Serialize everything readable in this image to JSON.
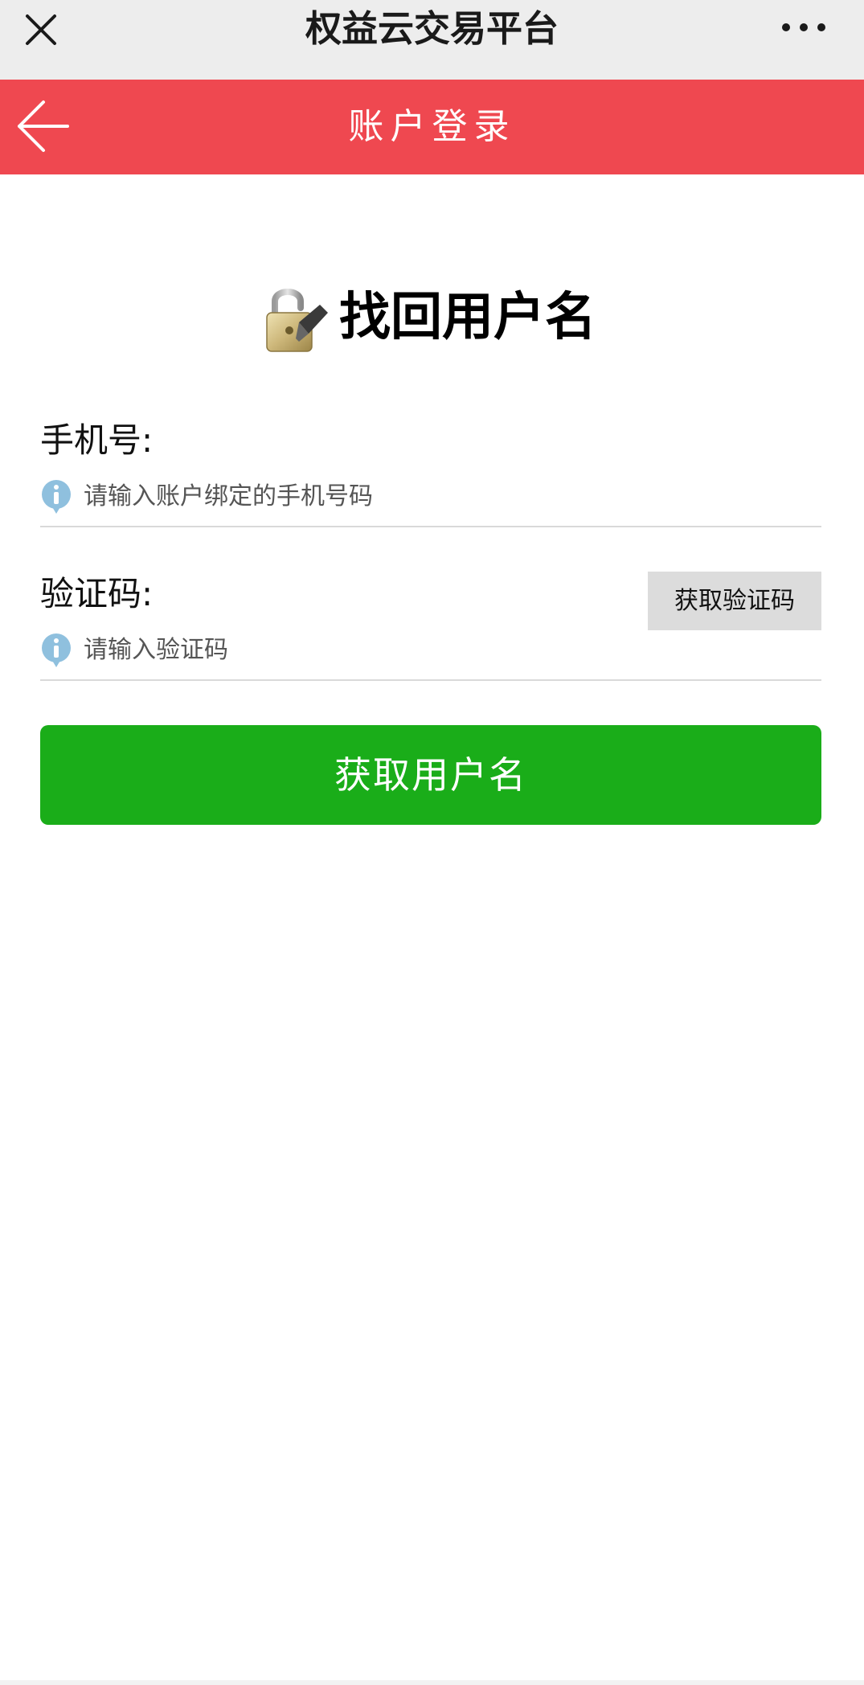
{
  "browser_bar": {
    "title": "权益云交易平台",
    "close_icon": "close-icon",
    "more_icon": "more-icon"
  },
  "header": {
    "title": "账户登录",
    "back_icon": "back-arrow-icon",
    "color": "#ef4850"
  },
  "page": {
    "title": "找回用户名",
    "lock_icon": "lock-icon"
  },
  "form": {
    "phone": {
      "label": "手机号:",
      "placeholder": "请输入账户绑定的手机号码"
    },
    "code": {
      "label": "验证码:",
      "placeholder": "请输入验证码",
      "get_code_label": "获取验证码"
    },
    "submit_label": "获取用户名",
    "submit_color": "#1aad19"
  }
}
